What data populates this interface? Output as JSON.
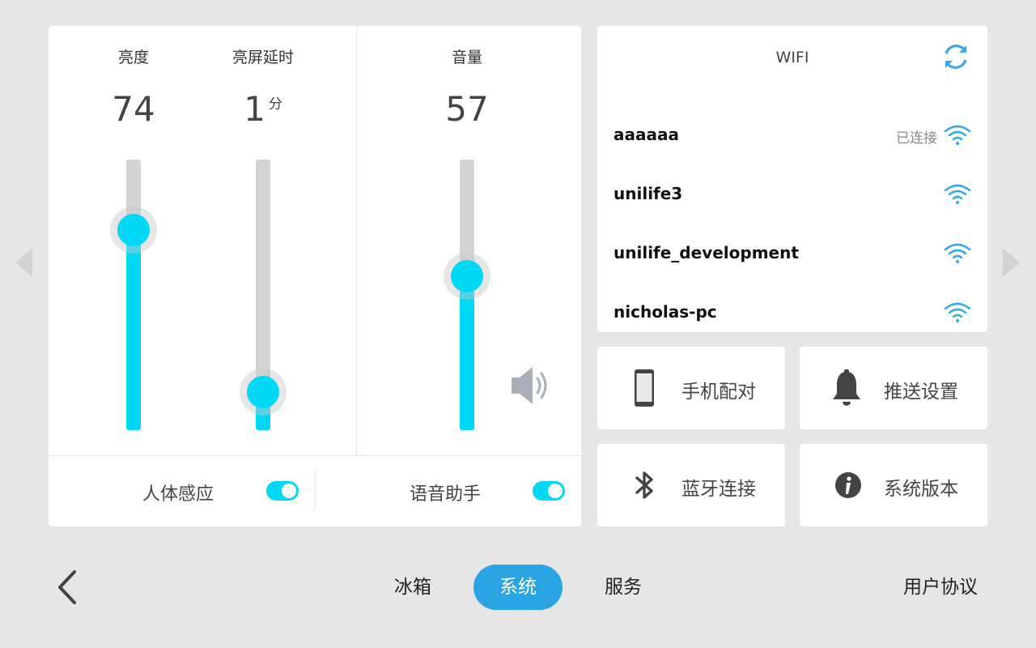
{
  "sliders": {
    "brightness": {
      "label": "亮度",
      "value": "74",
      "level": 0.74
    },
    "screen_timeout": {
      "label": "亮屏延时",
      "value": "1",
      "unit": "分",
      "level": 0.14
    },
    "volume": {
      "label": "音量",
      "value": "57",
      "level": 0.57
    }
  },
  "toggles": {
    "presence_sensing": {
      "label": "人体感应",
      "on": true
    },
    "voice_assistant": {
      "label": "语音助手",
      "on": true
    }
  },
  "wifi": {
    "title": "WIFI",
    "networks": [
      {
        "ssid": "aaaaaa",
        "status": "已连接"
      },
      {
        "ssid": "unilife3",
        "status": ""
      },
      {
        "ssid": "unilife_development",
        "status": ""
      },
      {
        "ssid": "nicholas-pc",
        "status": ""
      }
    ]
  },
  "tiles": {
    "phone_pairing": {
      "label": "手机配对",
      "icon": "phone-icon"
    },
    "push_settings": {
      "label": "推送设置",
      "icon": "bell-icon"
    },
    "bluetooth": {
      "label": "蓝牙连接",
      "icon": "bluetooth-icon"
    },
    "system_version": {
      "label": "系统版本",
      "icon": "info-icon"
    }
  },
  "nav": {
    "tabs": [
      {
        "label": "冰箱",
        "active": false
      },
      {
        "label": "系统",
        "active": true
      },
      {
        "label": "服务",
        "active": false
      }
    ],
    "user_agreement": "用户协议"
  },
  "colors": {
    "accent": "#00d8f5",
    "nav_active": "#2aa4e2",
    "wifi_icon": "#3aa9e8"
  }
}
